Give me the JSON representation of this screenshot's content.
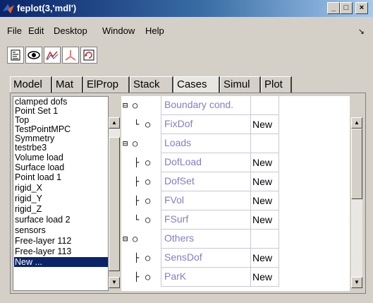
{
  "window": {
    "title": "feplot(3,'mdl')",
    "min_label": "_",
    "max_label": "□",
    "close_label": "×"
  },
  "menubar": {
    "items": [
      "File",
      "Edit",
      "Desktop",
      "Window",
      "Help"
    ],
    "arrow": "↘"
  },
  "toolbar": {
    "buttons": [
      "info-icon",
      "eye-icon",
      "mode-shape-icon",
      "axes-icon",
      "refresh-icon"
    ]
  },
  "tabs": [
    "Model",
    "Mat",
    "ElProp",
    "Stack",
    "Cases",
    "Simul",
    "Plot"
  ],
  "active_tab": "Cases",
  "list": {
    "items": [
      "clamped dofs",
      "Point Set 1",
      "Top",
      "TestPointMPC",
      "Symmetry",
      "testrbe3",
      "Volume load",
      "Surface load",
      "Point load 1",
      "rigid_X",
      "rigid_Y",
      "rigid_Z",
      "surface load 2",
      "sensors",
      "Free-layer 112",
      "Free-layer 113",
      "New ..."
    ],
    "selected": "New ..."
  },
  "tree": {
    "rows": [
      {
        "label": "Boundary cond.",
        "value": "",
        "kind": "group"
      },
      {
        "label": "FixDof",
        "value": "New",
        "kind": "last"
      },
      {
        "label": "Loads",
        "value": "",
        "kind": "group"
      },
      {
        "label": "DofLoad",
        "value": "New",
        "kind": "child"
      },
      {
        "label": "DofSet",
        "value": "New",
        "kind": "child"
      },
      {
        "label": "FVol",
        "value": "New",
        "kind": "child"
      },
      {
        "label": "FSurf",
        "value": "New",
        "kind": "last"
      },
      {
        "label": "Others",
        "value": "",
        "kind": "group"
      },
      {
        "label": "SensDof",
        "value": "New",
        "kind": "child"
      },
      {
        "label": "ParK",
        "value": "New",
        "kind": "child"
      }
    ]
  },
  "colors": {
    "title_start": "#0a246a",
    "title_end": "#a6caf0",
    "selection": "#0a246a",
    "tree_label": "#7f7fc8"
  }
}
